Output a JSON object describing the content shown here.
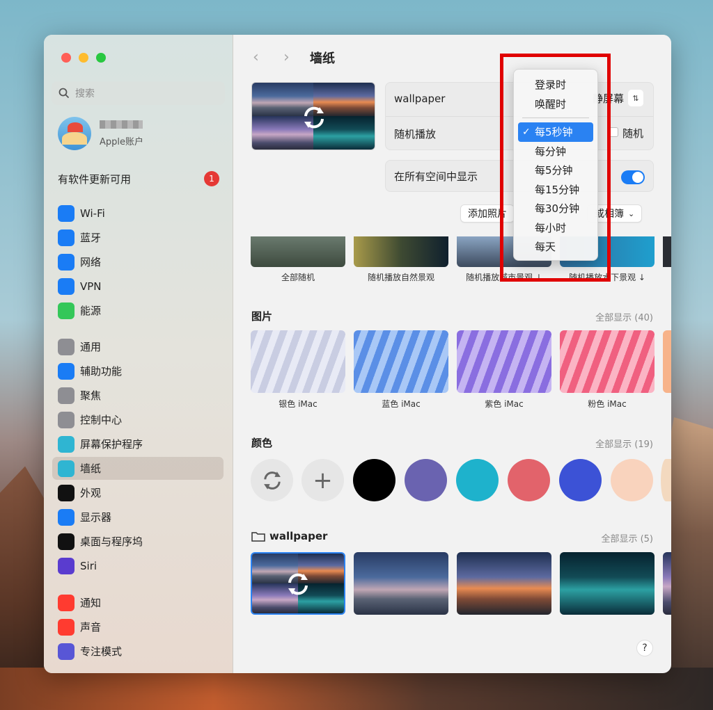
{
  "sidebar": {
    "search_placeholder": "搜索",
    "account_sub": "Apple账户",
    "update_label": "有软件更新可用",
    "update_badge": "1",
    "items": [
      {
        "label": "Wi-Fi",
        "icon": "wifi-icon",
        "color": "#1a7cf5"
      },
      {
        "label": "蓝牙",
        "icon": "bluetooth-icon",
        "color": "#1a7cf5"
      },
      {
        "label": "网络",
        "icon": "globe-icon",
        "color": "#1a7cf5"
      },
      {
        "label": "VPN",
        "icon": "vpn-globe-icon",
        "color": "#1a7cf5"
      },
      {
        "label": "能源",
        "icon": "battery-bolt-icon",
        "color": "#34c759"
      },
      {
        "label": "通用",
        "icon": "gear-icon",
        "color": "#8e8e93"
      },
      {
        "label": "辅助功能",
        "icon": "accessibility-icon",
        "color": "#1a7cf5"
      },
      {
        "label": "聚焦",
        "icon": "magnifier-icon",
        "color": "#8e8e93"
      },
      {
        "label": "控制中心",
        "icon": "switches-icon",
        "color": "#8e8e93"
      },
      {
        "label": "屏幕保护程序",
        "icon": "screensaver-icon",
        "color": "#2fb5d2"
      },
      {
        "label": "墙纸",
        "icon": "flower-icon",
        "color": "#2fb5d2"
      },
      {
        "label": "外观",
        "icon": "appearance-icon",
        "color": "#111111"
      },
      {
        "label": "显示器",
        "icon": "sun-icon",
        "color": "#1a7cf5"
      },
      {
        "label": "桌面与程序坞",
        "icon": "dock-icon",
        "color": "#111111"
      },
      {
        "label": "Siri",
        "icon": "siri-icon",
        "color": "#5a3ccf"
      },
      {
        "label": "通知",
        "icon": "bell-icon",
        "color": "#ff3b30"
      },
      {
        "label": "声音",
        "icon": "speaker-icon",
        "color": "#ff3b30"
      },
      {
        "label": "专注模式",
        "icon": "moon-icon",
        "color": "#5856d6"
      }
    ]
  },
  "header": {
    "title": "墙纸"
  },
  "settings": {
    "wallpaper_label": "wallpaper",
    "screen_select": "静屏幕",
    "shuffle_label": "随机播放",
    "random_label": "随机",
    "all_spaces_label": "在所有空间中显示",
    "all_spaces_on": true,
    "add_photo_button": "添加照片",
    "album_button": "或相簿"
  },
  "dropdown": {
    "top_items": [
      "登录时",
      "唤醒时"
    ],
    "items": [
      "每5秒钟",
      "每分钟",
      "每5分钟",
      "每15分钟",
      "每30分钟",
      "每小时",
      "每天"
    ],
    "selected": "每5秒钟"
  },
  "dynamic": {
    "items": [
      "全部随机",
      "随机播放自然景观",
      "随机播放城市景观 ↓",
      "随机播放水下景观 ↓"
    ]
  },
  "pictures": {
    "title": "图片",
    "show_all": "全部显示 (40)",
    "items": [
      "银色 iMac",
      "蓝色 iMac",
      "紫色 iMac",
      "粉色 iMac"
    ]
  },
  "colors": {
    "title": "颜色",
    "show_all": "全部显示 (19)",
    "swatches": [
      "#000000",
      "#6a63b0",
      "#1eb2cc",
      "#e2636b",
      "#3c52d6",
      "#f9d3bd"
    ]
  },
  "folder": {
    "title": "wallpaper",
    "show_all": "全部显示 (5)"
  },
  "help_label": "?"
}
